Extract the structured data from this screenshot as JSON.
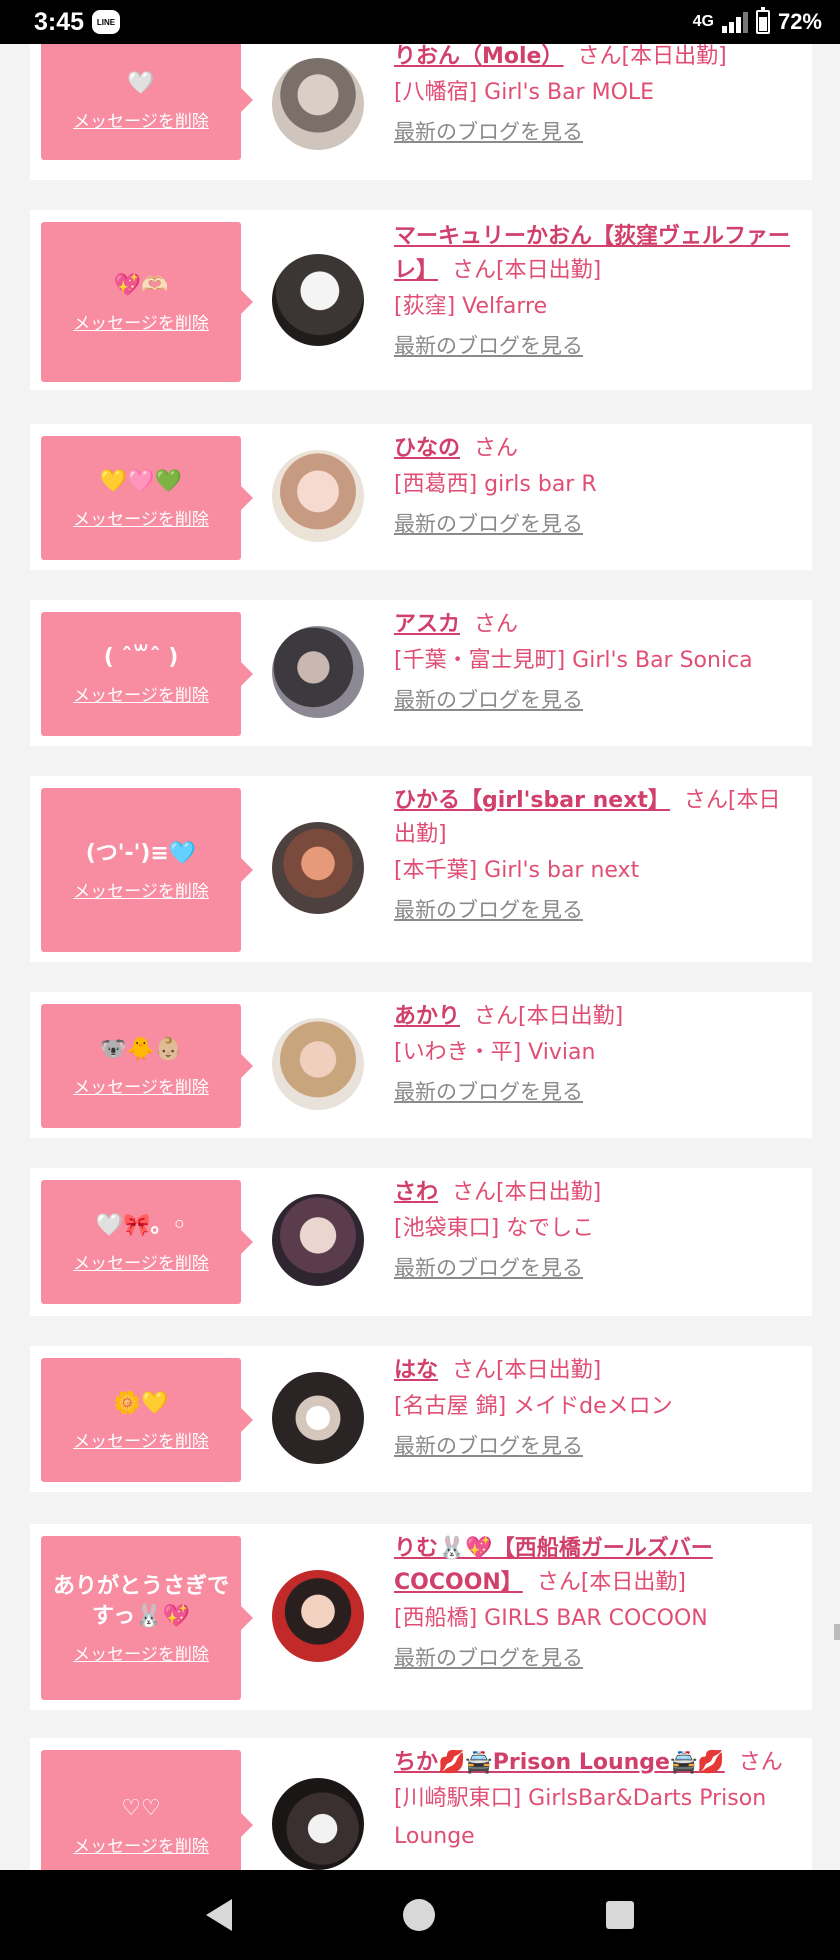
{
  "status": {
    "time": "3:45",
    "app_badge": "LINE",
    "network": "4G",
    "battery": "72%"
  },
  "items": [
    {
      "message": "🤍",
      "delete_label": "メッセージを削除",
      "name": "りおん（Mole）",
      "suffix": "さん[本日出勤]",
      "shop": "[八幡宿] Girl's Bar MOLE",
      "blog_label": "最新のブログを見る"
    },
    {
      "message": "💖🫶🏻",
      "delete_label": "メッセージを削除",
      "name": "マーキュリーかおん【荻窪ヴェルファーレ】",
      "suffix": "さん[本日出勤]",
      "shop": "[荻窪] Velfarre",
      "blog_label": "最新のブログを見る"
    },
    {
      "message": "💛🩷💚",
      "delete_label": "メッセージを削除",
      "name": "ひなの",
      "suffix": "さん",
      "shop": "[西葛西] girls bar R",
      "blog_label": "最新のブログを見る"
    },
    {
      "message": "( ˆ꒳ˆ )",
      "delete_label": "メッセージを削除",
      "name": "アスカ",
      "suffix": "さん",
      "shop": "[千葉・富士見町] Girl's Bar Sonica",
      "blog_label": "最新のブログを見る"
    },
    {
      "message": "(つ'-')≡🩵",
      "delete_label": "メッセージを削除",
      "name": "ひかる【girl'sbar next】",
      "suffix": "さん[本日出勤]",
      "shop": "[本千葉] Girl's bar next",
      "blog_label": "最新のブログを見る"
    },
    {
      "message": "🐨🐥👶🏼",
      "delete_label": "メッセージを削除",
      "name": "あかり",
      "suffix": "さん[本日出勤]",
      "shop": "[いわき・平] Vivian",
      "blog_label": "最新のブログを見る"
    },
    {
      "message": "🤍🎀。◦",
      "delete_label": "メッセージを削除",
      "name": "さわ",
      "suffix": "さん[本日出勤]",
      "shop": "[池袋東口] なでしこ",
      "blog_label": "最新のブログを見る"
    },
    {
      "message": "🌼💛",
      "delete_label": "メッセージを削除",
      "name": "はな",
      "suffix": "さん[本日出勤]",
      "shop": "[名古屋 錦] メイドdeメロン",
      "blog_label": "最新のブログを見る"
    },
    {
      "message": "ありがとうさぎですっ🐰💖",
      "delete_label": "メッセージを削除",
      "name": "りむ🐰💖【西船橋ガールズバーCOCOON】",
      "suffix": "さん[本日出勤]",
      "shop": "[西船橋] GIRLS BAR COCOON",
      "blog_label": "最新のブログを見る"
    },
    {
      "message": "♡♡",
      "delete_label": "メッセージを削除",
      "name": "ちか💋🚔Prison Lounge🚔💋",
      "suffix": "さん",
      "shop": "[川崎駅東口] GirlsBar&Darts Prison Lounge",
      "blog_label": ""
    }
  ],
  "colors": {
    "accent": "#f88ca1",
    "name_pink": "#d1406c",
    "text_pink": "#e04d75",
    "muted": "#8a8a8a",
    "background": "#f3f3f3"
  },
  "nav": {
    "back_icon": "back-triangle",
    "home_icon": "home-circle",
    "recents_icon": "recents-square"
  }
}
